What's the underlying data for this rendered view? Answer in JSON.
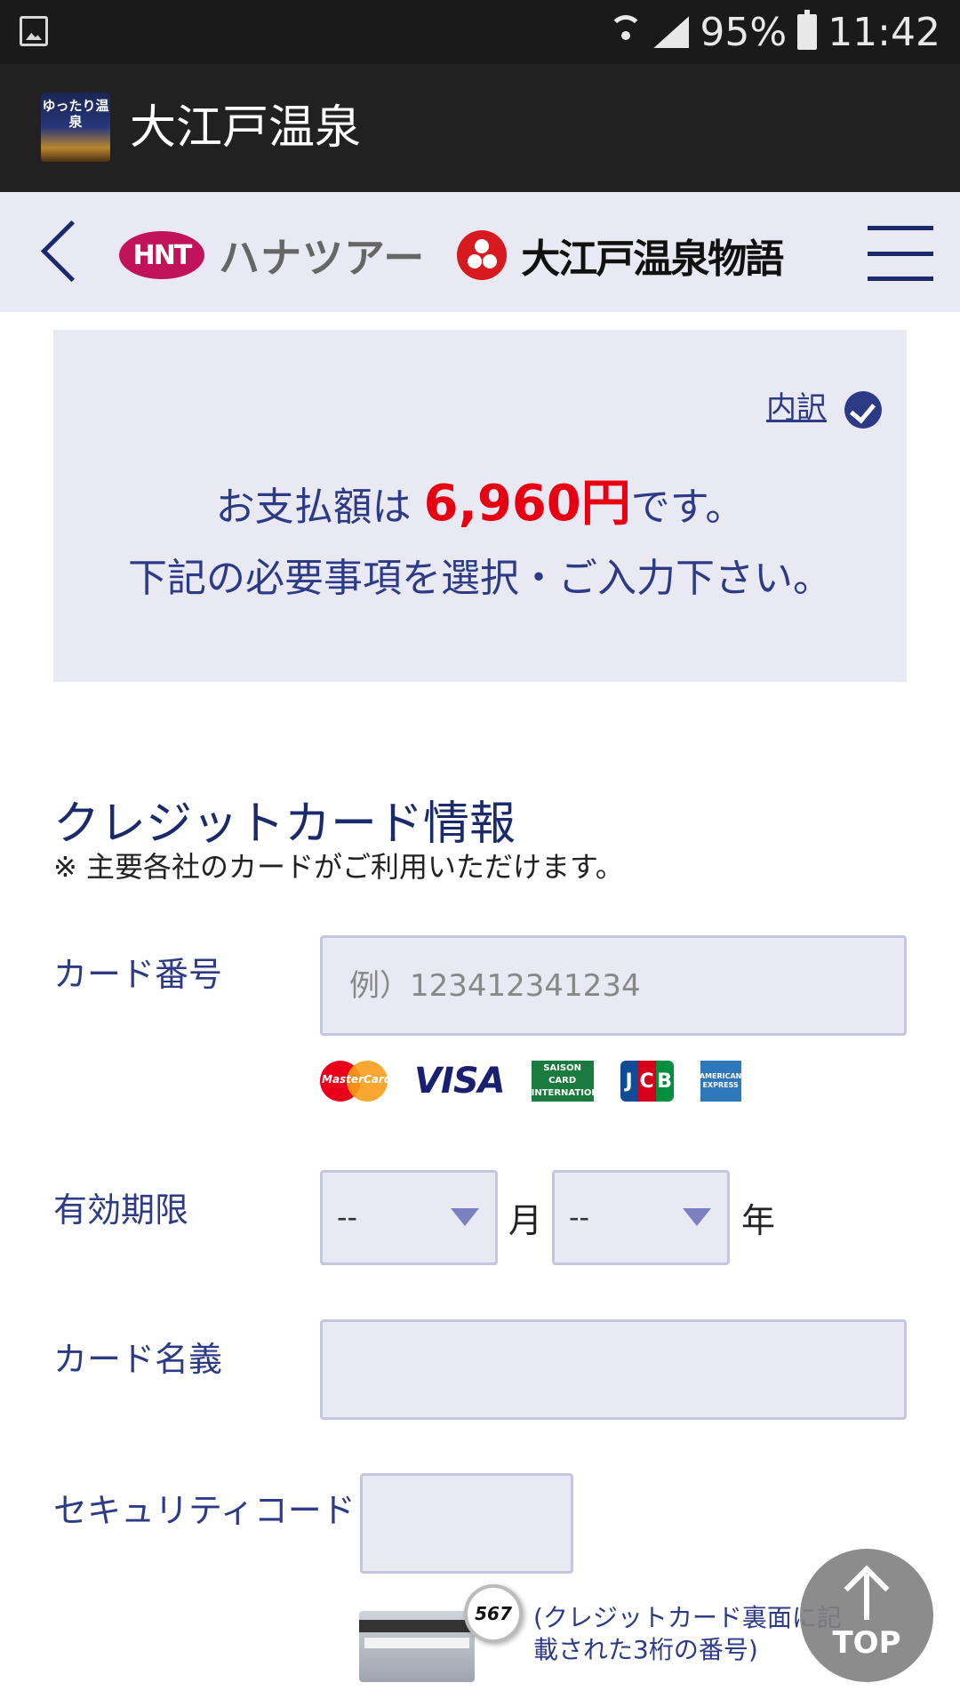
{
  "status_bar": {
    "battery": "95%",
    "time": "11:42"
  },
  "app_bar": {
    "title": "大江戸温泉",
    "logo_text": "ゆったり温泉"
  },
  "site_header": {
    "partner": "ハナツアー",
    "partner_mark": "HNT",
    "brand": "大江戸温泉物語"
  },
  "summary": {
    "breakdown_link": "内訳",
    "pay_prefix": "お支払額は ",
    "pay_amount": "6,960円",
    "pay_suffix": "です。",
    "instruction": "下記の必要事項を選択・ご入力下さい。"
  },
  "credit_card": {
    "title": "クレジットカード情報",
    "note": "※ 主要各社のカードがご利用いただけます。",
    "card_number_label": "カード番号",
    "card_number_placeholder": "例）123412341234",
    "brands": [
      "MasterCard",
      "VISA",
      "SAISON CARD INTERNATIONAL",
      "JCB",
      "AMERICAN EXPRESS"
    ],
    "expiry_label": "有効期限",
    "month_value": "--",
    "month_unit": "月",
    "year_value": "--",
    "year_unit": "年",
    "holder_label": "カード名義",
    "holder_value": "",
    "security_label": "セキュリティコード",
    "security_value": "",
    "security_sample": "567",
    "security_note": "(クレジットカード裏面に記載された3桁の番号)"
  },
  "top_button": {
    "label": "TOP"
  }
}
